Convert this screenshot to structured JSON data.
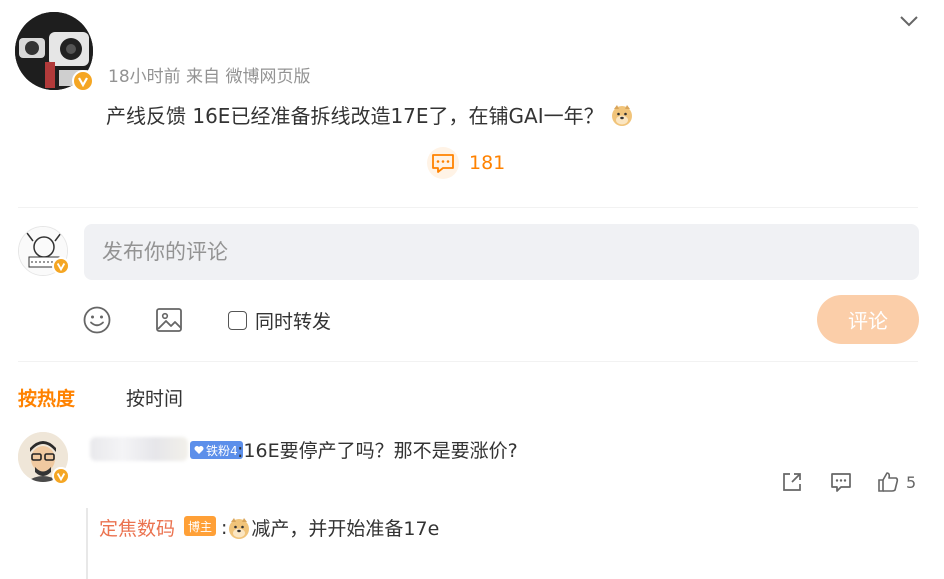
{
  "post": {
    "meta": "18小时前 来自 微博网页版",
    "text": "产线反馈 16E已经准备拆线改造17E了，在铺GAI一年？",
    "emoji": "doge",
    "comment_count": "181"
  },
  "composer": {
    "placeholder": "发布你的评论",
    "repost_label": "同时转发",
    "submit_label": "评论"
  },
  "sort": {
    "hot_label": "按热度",
    "time_label": "按时间"
  },
  "comment": {
    "fan_badge": "铁粉4",
    "text": ":16E要停产了吗？那不是要涨价?",
    "like_count": "5",
    "reply": {
      "author": "定焦数码",
      "badge": "博主",
      "prefix": ":",
      "emoji": "doge",
      "text": "减产，并开始准备17e"
    }
  },
  "colors": {
    "accent": "#ff8200",
    "reply_author": "#eb7350",
    "fan_badge": "#5c8fea",
    "host_badge": "#ffa037",
    "submit_bg": "#fbcea9",
    "verified": "#f5a623"
  },
  "icons": [
    "chevron-down-icon",
    "comment-icon",
    "emoji-icon",
    "image-icon",
    "share-icon",
    "comment-icon",
    "like-icon",
    "doge-emoji",
    "verified-badge-icon"
  ]
}
